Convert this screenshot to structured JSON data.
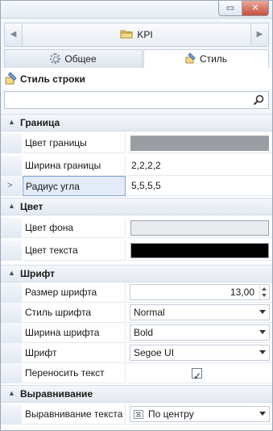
{
  "header": {
    "title": "KPI"
  },
  "tabs": {
    "general": "Общее",
    "style": "Стиль"
  },
  "style_panel": {
    "title": "Стиль строки"
  },
  "search": {
    "value": "",
    "placeholder": ""
  },
  "categories": {
    "border": {
      "label": "Граница",
      "border_color_label": "Цвет границы",
      "border_color_value": "#9a9ea3",
      "border_width_label": "Ширина границы",
      "border_width_value": "2,2,2,2",
      "corner_radius_label": "Радиус угла",
      "corner_radius_value": "5,5,5,5"
    },
    "color": {
      "label": "Цвет",
      "background_label": "Цвет фона",
      "background_value": "#e9ebee",
      "text_color_label": "Цвет текста",
      "text_color_value": "#000000"
    },
    "font": {
      "label": "Шрифт",
      "size_label": "Размер шрифта",
      "size_value": "13,00",
      "style_label": "Стиль шрифта",
      "style_value": "Normal",
      "weight_label": "Ширина шрифта",
      "weight_value": "Bold",
      "family_label": "Шрифт",
      "family_value": "Segoe UI",
      "wrap_label": "Переносить текст",
      "wrap_checked": true
    },
    "alignment": {
      "label": "Выравнивание",
      "text_align_label": "Выравнивание текста",
      "text_align_value": "По центру"
    }
  }
}
